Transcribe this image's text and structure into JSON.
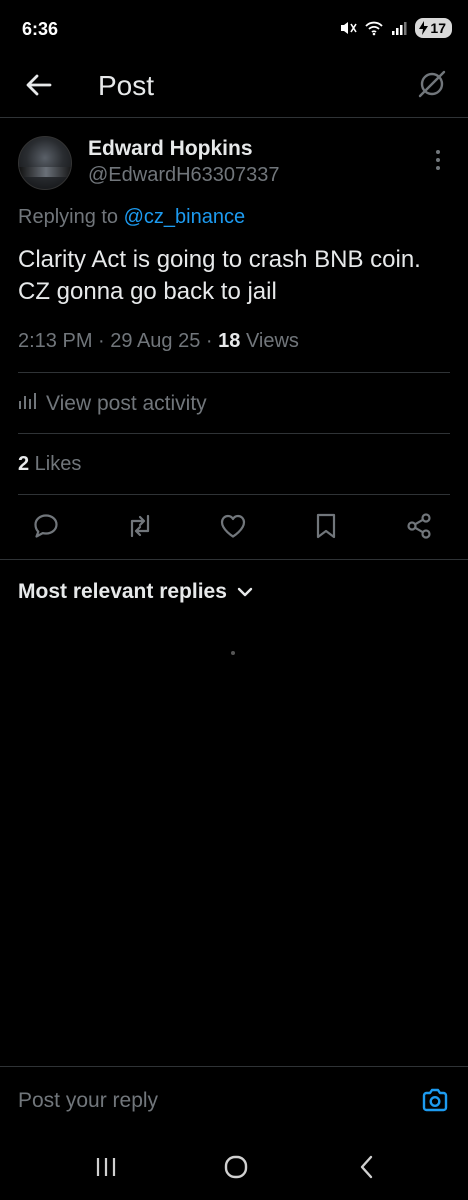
{
  "status_bar": {
    "time": "6:36",
    "battery_level": "17"
  },
  "header": {
    "title": "Post"
  },
  "post": {
    "author": {
      "display_name": "Edward Hopkins",
      "handle": "@EdwardH63307337"
    },
    "replying_to": {
      "prefix": "Replying to ",
      "mention": "@cz_binance"
    },
    "text": "Clarity Act is going to crash BNB coin. CZ gonna go back to jail",
    "time": "2:13 PM",
    "date": "29 Aug 25",
    "views_count": "18",
    "views_label": " Views",
    "view_activity_label": "View post activity",
    "likes_count": "2",
    "likes_label": " Likes"
  },
  "replies_sort": {
    "label": "Most relevant replies"
  },
  "reply_bar": {
    "placeholder": "Post your reply"
  },
  "icons": {
    "back": "arrow-left-icon",
    "grok": "grok-icon",
    "more": "more-vertical-icon",
    "activity": "bar-chart-icon",
    "reply": "reply-icon",
    "repost": "repost-icon",
    "like": "heart-icon",
    "bookmark": "bookmark-icon",
    "share": "share-icon",
    "camera": "camera-icon"
  },
  "colors": {
    "accent": "#1d9bf0",
    "text": "#e7e9ea",
    "muted": "#71767b",
    "border": "#2f3336",
    "background": "#000000"
  }
}
